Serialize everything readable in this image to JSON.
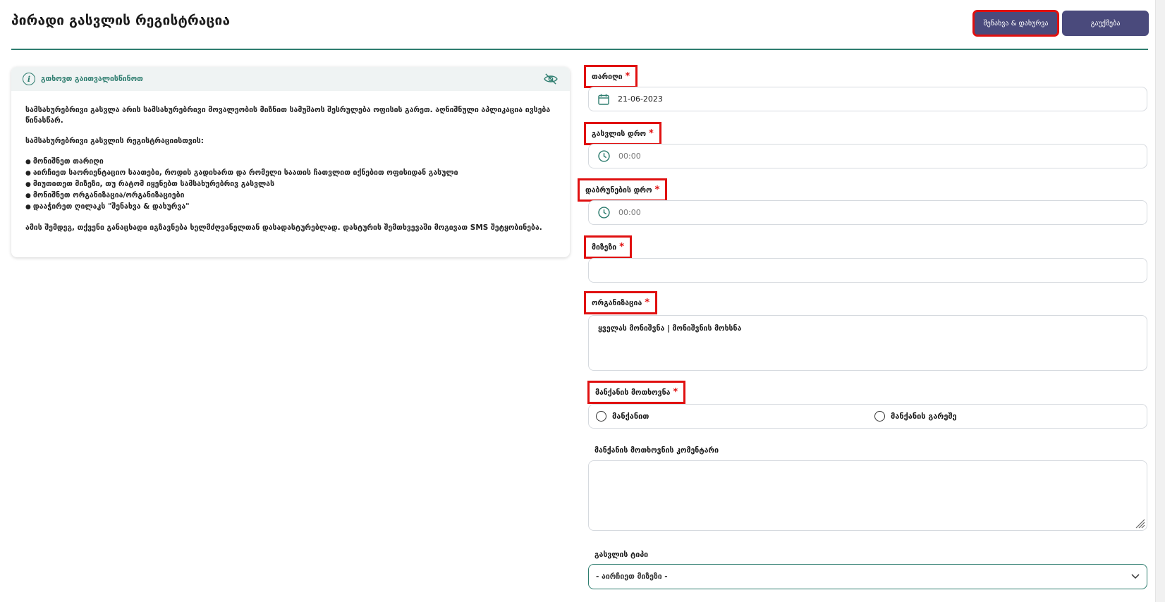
{
  "page": {
    "title": "პირადი გასვლის რეგისტრაცია"
  },
  "toolbar": {
    "save_label": "შენახვა & დახურვა",
    "cancel_label": "გაუქმება"
  },
  "info": {
    "title": "გთხოვთ გაითვალისწინოთ",
    "paragraph1": "სამსახურებრივი გასვლა არის სამსახურებრივი მოვალეობის მიზნით სამუშაოს შესრულება ოფისის გარეთ. აღნიშნული აპლიკაცია ივსება წინასწარ.",
    "paragraph2": "სამსახურებრივი გასვლის რეგისტრაციისთვის:",
    "bullets": [
      "მონიშნეთ თარიღი",
      "აირჩიეთ საორიენტაციო საათები, როდის გადიხართ და რომელი საათის ჩათვლით იქნებით ოფისიდან გასული",
      "მიუთითეთ მიზეზი, თუ რატომ იყენებთ სამსახურებრივ გასვლას",
      "მონიშნეთ ორგანიზაცია/ორგანიზაციები",
      "დააჭირეთ ღილაკს \"შენახვა & დახურვა\""
    ],
    "paragraph3": "ამის შემდეგ, თქვენი განაცხადი იგზავნება ხელმძღვანელთან დასადასტურებლად. დასტურის შემთხვევაში მოგივათ SMS შეტყობინება."
  },
  "form": {
    "date": {
      "label": "თარიღი",
      "value": "21-06-2023",
      "icon": "calendar-icon"
    },
    "departure_time": {
      "label": "გასვლის დრო",
      "placeholder": "00:00",
      "icon": "clock-icon"
    },
    "return_time": {
      "label": "დაბრუნების დრო",
      "placeholder": "00:00",
      "icon": "clock-icon"
    },
    "reason": {
      "label": "მიზეზი",
      "value": ""
    },
    "organization": {
      "label": "ორგანიზაცია",
      "value": "ყველას მონიშვნა | მონიშვნის მოხსნა"
    },
    "car_request": {
      "label": "მანქანის მოთხოვნა",
      "options": [
        "მანქანით",
        "მანქანის გარეშე"
      ]
    },
    "car_comment": {
      "label": "მანქანის მოთხოვნის კომენტარი",
      "value": ""
    },
    "exit_type": {
      "label": "გასვლის ტიპი",
      "selected": "- აირჩიეთ მიზეზი -"
    }
  },
  "colors": {
    "accent": "#2e7d6f",
    "button": "#4a4a7c",
    "highlight": "#e01010",
    "required": "#e01010"
  }
}
